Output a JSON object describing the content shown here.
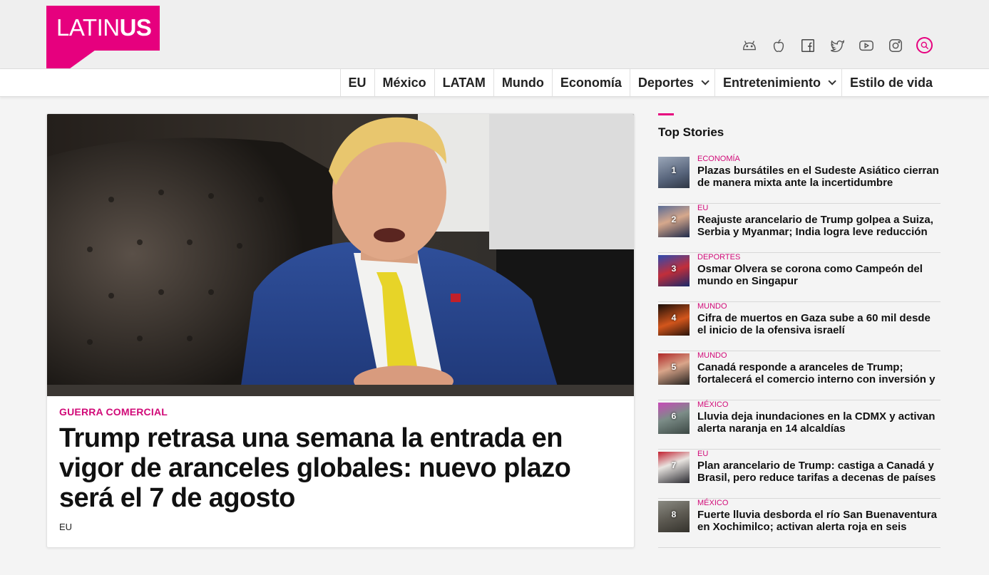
{
  "brand": {
    "name_light": "LATIN",
    "name_bold": "US",
    "color": "#e6007e"
  },
  "social_icons": [
    "android-icon",
    "apple-icon",
    "facebook-icon",
    "twitter-icon",
    "youtube-icon",
    "instagram-icon",
    "search-icon"
  ],
  "nav": [
    {
      "label": "EU",
      "dropdown": false
    },
    {
      "label": "México",
      "dropdown": false
    },
    {
      "label": "LATAM",
      "dropdown": false
    },
    {
      "label": "Mundo",
      "dropdown": false
    },
    {
      "label": "Economía",
      "dropdown": false
    },
    {
      "label": "Deportes",
      "dropdown": true
    },
    {
      "label": "Entretenimiento",
      "dropdown": true
    },
    {
      "label": "Estilo de vida",
      "dropdown": false
    }
  ],
  "main_story": {
    "kicker": "GUERRA COMERCIAL",
    "headline": "Trump retrasa una semana la entrada en vigor de aranceles globales: nuevo plazo será el 7 de agosto",
    "section": "EU"
  },
  "sidebar": {
    "title": "Top Stories",
    "stories": [
      {
        "num": "1",
        "category": "ECONOMÍA",
        "title": "Plazas bursátiles en el Sudeste Asiático cierran de manera mixta ante la incertidumbre"
      },
      {
        "num": "2",
        "category": "EU",
        "title": "Reajuste arancelario de Trump golpea a Suiza, Serbia y Myanmar; India logra leve reducción"
      },
      {
        "num": "3",
        "category": "DEPORTES",
        "title": "Osmar Olvera se corona como Campeón del mundo en Singapur"
      },
      {
        "num": "4",
        "category": "MUNDO",
        "title": "Cifra de muertos en Gaza sube a 60 mil desde el inicio de la ofensiva israelí"
      },
      {
        "num": "5",
        "category": "MUNDO",
        "title": "Canadá responde a aranceles de Trump; fortalecerá el comercio interno con inversión y"
      },
      {
        "num": "6",
        "category": "MÉXICO",
        "title": "Lluvia deja inundaciones en la CDMX y activan alerta naranja en 14 alcaldías"
      },
      {
        "num": "7",
        "category": "EU",
        "title": "Plan arancelario de Trump: castiga a Canadá y Brasil, pero reduce tarifas a decenas de países"
      },
      {
        "num": "8",
        "category": "MÉXICO",
        "title": "Fuerte lluvia desborda el río San Buenaventura en Xochimilco; activan alerta roja en seis"
      }
    ]
  },
  "colors": {
    "accent": "#e6007e",
    "kicker": "#d10a78"
  }
}
